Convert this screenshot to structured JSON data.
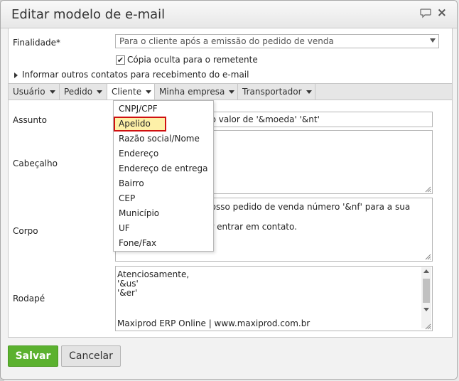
{
  "dialog": {
    "title": "Editar modelo de e-mail",
    "close_glyph": "×"
  },
  "form": {
    "finalidade_label": "Finalidade*",
    "finalidade_value": "Para o cliente após a emissão do pedido de venda",
    "copia_checked": "✔",
    "copia_label": "Cópia oculta para o remetente",
    "outros_contatos": "Informar outros contatos para recebimento do e-mail",
    "assunto_label": "Assunto",
    "assunto_visible": "no valor de '&moeda' '&nt'",
    "cabecalho_label": "Cabeçalho",
    "corpo_label": "Corpo",
    "corpo_line1": "nosso pedido de venda número '&nf' para a sua",
    "corpo_line2": "or entrar em contato.",
    "rodape_label": "Rodapé",
    "rodape_lines": [
      "Atenciosamente,",
      "'&us'",
      "'&er'",
      "",
      "Maxiprod ERP Online | www.maxiprod.com.br"
    ]
  },
  "toolbar": {
    "items": [
      "Usuário",
      "Pedido",
      "Cliente",
      "Minha empresa",
      "Transportador"
    ]
  },
  "dropdown": {
    "items": [
      "CNPJ/CPF",
      "Apelido",
      "Razão social/Nome",
      "Endereço",
      "Endereço de entrega",
      "Bairro",
      "CEP",
      "Município",
      "UF",
      "Fone/Fax"
    ],
    "highlighted": "Apelido"
  },
  "buttons": {
    "save": "Salvar",
    "cancel": "Cancelar"
  },
  "colors": {
    "save_button": "#5bb12f",
    "highlight_fill": "#fdf0a8",
    "highlight_border": "#d01010"
  }
}
